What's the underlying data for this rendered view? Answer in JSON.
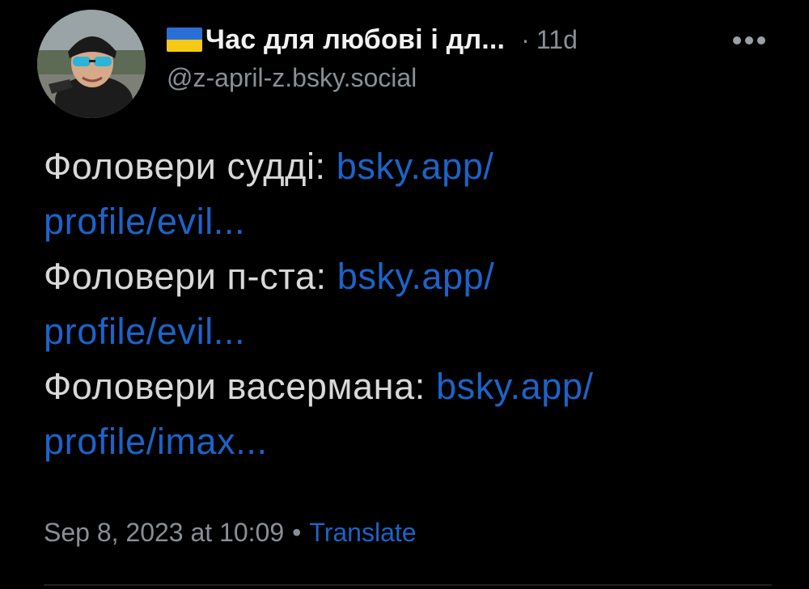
{
  "post": {
    "author": {
      "display_name": "Час для любові і дл...",
      "handle": "@z-april-z.bsky.social",
      "flag_icon": "ukraine-flag-icon"
    },
    "timestamp_sep": "·",
    "timestamp": "11d",
    "more_icon": "more-horizontal-icon",
    "content": [
      {
        "text": "Фоловери судді: ",
        "link_part1": "bsky.app/",
        "link_part2": "profile/evil..."
      },
      {
        "text": "Фоловери п-ста: ",
        "link_part1": "bsky.app/",
        "link_part2": "profile/evil..."
      },
      {
        "text": "Фоловери васермана: ",
        "link_part1": "bsky.app/",
        "link_part2": "profile/imax..."
      }
    ],
    "footer": {
      "datetime": "Sep 8, 2023 at 10:09",
      "dot": "•",
      "translate_label": "Translate"
    }
  },
  "colors": {
    "background": "#000000",
    "text": "#d9d9d9",
    "muted": "#8a8f96",
    "link": "#1d63c8",
    "flag_blue": "#2a6fd6",
    "flag_yellow": "#f6c915"
  }
}
